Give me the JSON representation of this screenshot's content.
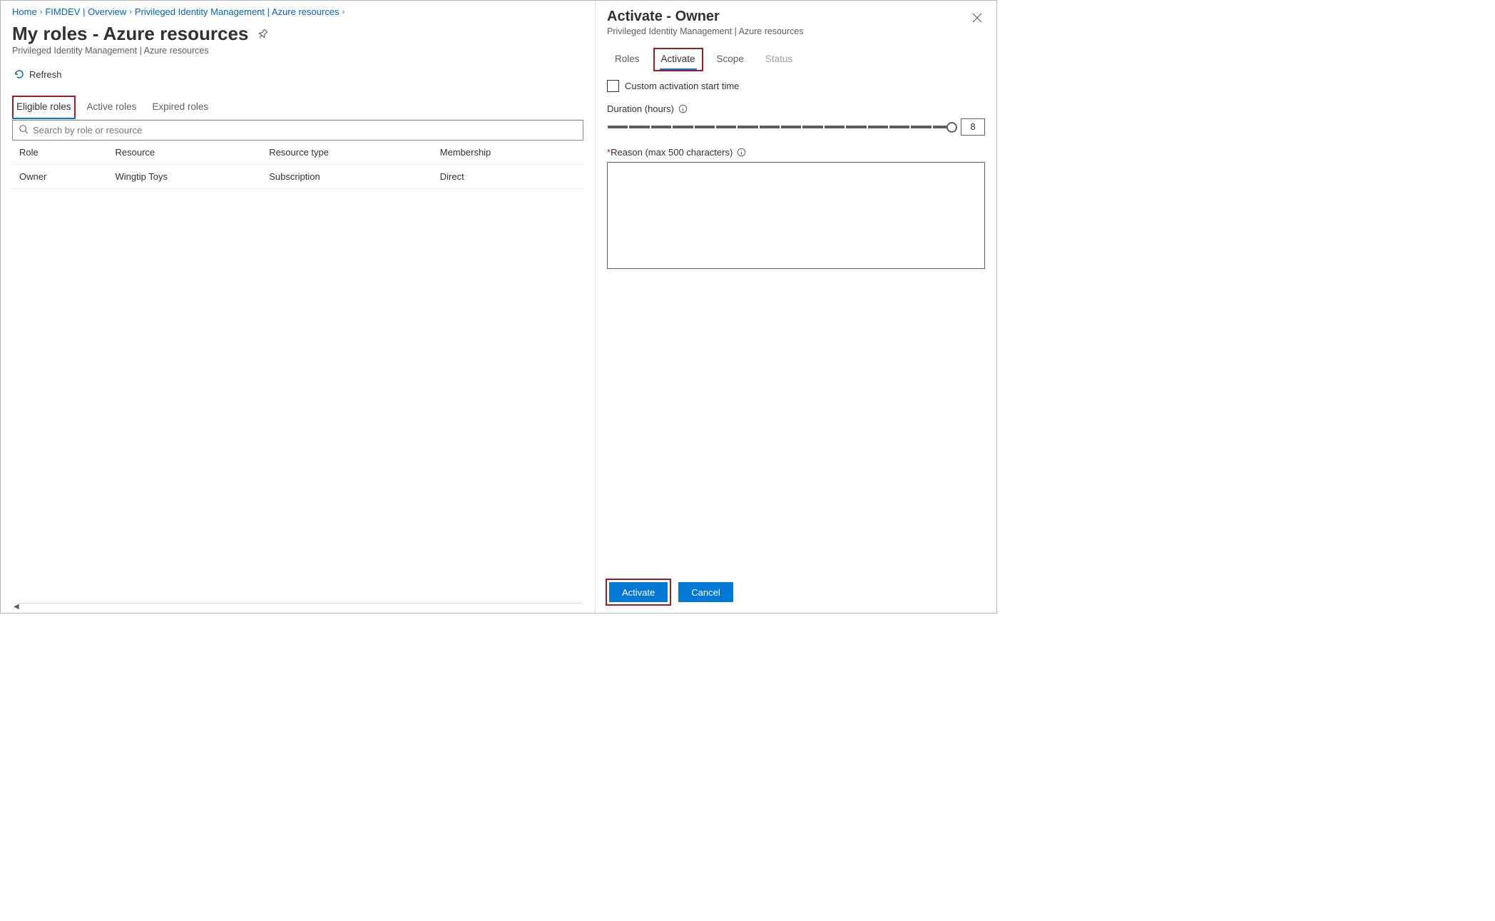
{
  "breadcrumb": {
    "items": [
      {
        "label": "Home"
      },
      {
        "label": "FIMDEV | Overview"
      },
      {
        "label": "Privileged Identity Management | Azure resources"
      }
    ]
  },
  "page": {
    "title": "My roles - Azure resources",
    "subtitle": "Privileged Identity Management | Azure resources",
    "refresh_label": "Refresh"
  },
  "tabs": {
    "eligible": "Eligible roles",
    "active": "Active roles",
    "expired": "Expired roles"
  },
  "search": {
    "placeholder": "Search by role or resource"
  },
  "table": {
    "headers": {
      "role": "Role",
      "resource": "Resource",
      "resource_type": "Resource type",
      "membership": "Membership"
    },
    "row": {
      "role": "Owner",
      "resource": "Wingtip Toys",
      "resource_type": "Subscription",
      "membership": "Direct"
    }
  },
  "blade": {
    "title": "Activate - Owner",
    "subtitle": "Privileged Identity Management | Azure resources",
    "tabs": {
      "roles": "Roles",
      "activate": "Activate",
      "scope": "Scope",
      "status": "Status"
    },
    "custom_start_label": "Custom activation start time",
    "duration_label": "Duration (hours)",
    "duration_value": "8",
    "reason_label": "Reason (max 500 characters)",
    "activate_btn": "Activate",
    "cancel_btn": "Cancel"
  }
}
